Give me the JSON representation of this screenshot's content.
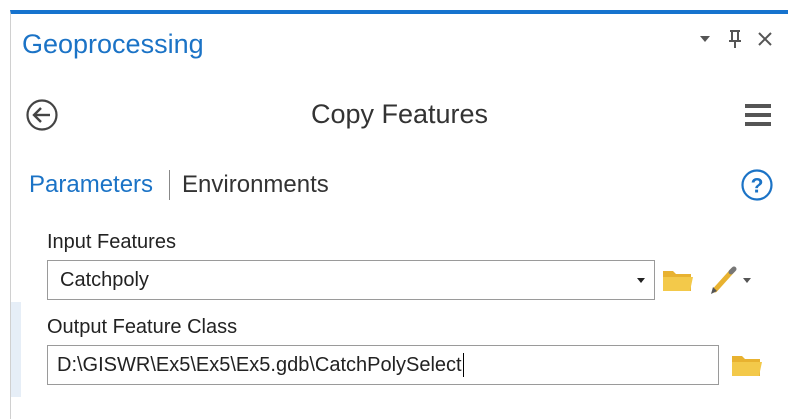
{
  "pane": {
    "title": "Geoprocessing",
    "controls": {
      "dropdown_icon": "caret-down-icon",
      "pin_icon": "pin-icon",
      "close_icon": "close-icon"
    }
  },
  "tool": {
    "back_icon": "back-arrow-icon",
    "title": "Copy Features",
    "menu_icon": "hamburger-menu-icon"
  },
  "tabs": {
    "parameters": "Parameters",
    "environments": "Environments",
    "help_icon": "help-icon"
  },
  "params": {
    "input_features": {
      "label": "Input Features",
      "value": "Catchpoly"
    },
    "output_feature_class": {
      "label": "Output Feature Class",
      "value": "D:\\GISWR\\Ex5\\Ex5\\Ex5.gdb\\CatchPolySelect"
    }
  },
  "colors": {
    "accent": "#1b73c6",
    "top_border": "#1673ce",
    "folder": "#e8b230"
  }
}
